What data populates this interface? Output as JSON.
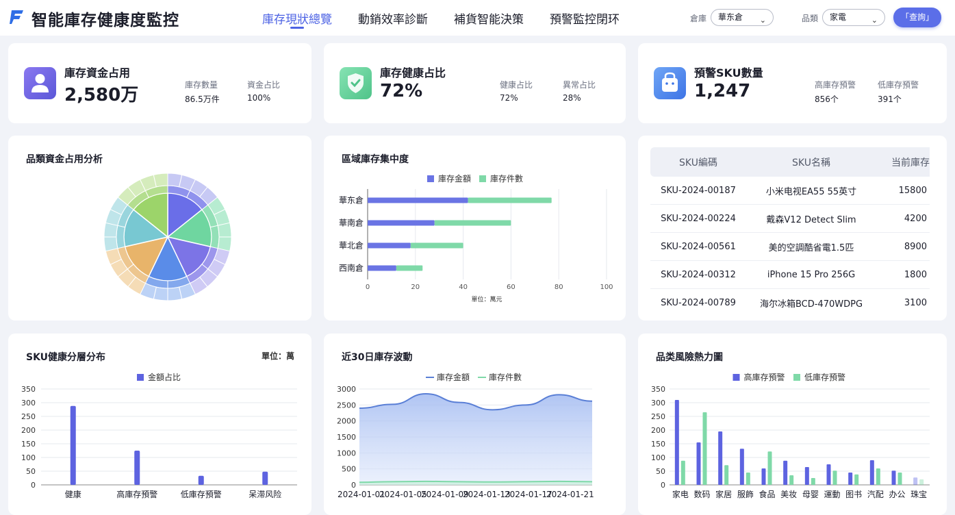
{
  "header": {
    "app_title": "智能庫存健康度監控",
    "tabs": [
      {
        "label": "庫存現狀總覽"
      },
      {
        "label": "動銷效率診斷"
      },
      {
        "label": "補貨智能決策"
      },
      {
        "label": "預警監控閉环"
      }
    ],
    "warehouse_label": "倉庫",
    "warehouse_value": "華东倉",
    "category_label": "品類",
    "category_value": "家電",
    "query_button": "「查詢」",
    "accent_color": "#4d63e4"
  },
  "kpis": [
    {
      "title": "庫存資金占用",
      "value": "2,580万",
      "icon": "user-icon",
      "subs": [
        {
          "label": "庫存數量",
          "value": "86.5万件"
        },
        {
          "label": "資金占比",
          "value": "100%"
        }
      ]
    },
    {
      "title": "庫存健康占比",
      "value": "72%",
      "icon": "shield-check-icon",
      "subs": [
        {
          "label": "健康占比",
          "value": "72%"
        },
        {
          "label": "異常占比",
          "value": "28%"
        }
      ]
    },
    {
      "title": "預警SKU數量",
      "value": "1,247",
      "icon": "bag-icon",
      "subs": [
        {
          "label": "高庫存預警",
          "value": "856个"
        },
        {
          "label": "低庫存預警",
          "value": "391个"
        }
      ]
    }
  ],
  "sunburst": {
    "title": "品類資金占用分析",
    "inner_colors": [
      "#6a6ee8",
      "#6fd6a0",
      "#7c74e6",
      "#5a8ce8",
      "#e8b46a",
      "#78c8d2",
      "#9cd46a"
    ],
    "outer_colors": [
      "#c7c9f4",
      "#b7ecd1",
      "#cfcbf5",
      "#bcd2f6",
      "#f5dcb6",
      "#bfe5ea",
      "#d5ecbc"
    ]
  },
  "region_chart": {
    "title": "區域庫存集中度",
    "legend": [
      "庫存金額",
      "庫存件數"
    ],
    "colors": [
      "#6a74e4",
      "#7fd9a8"
    ],
    "unit": "單位：萬元"
  },
  "sku_table": {
    "headers": [
      "SKU編碼",
      "SKU名稱",
      "当前庫存"
    ],
    "rows": [
      [
        "SKU-2024-00187",
        "小米电视EA55 55英寸",
        "15800"
      ],
      [
        "SKU-2024-00224",
        "戴森V12 Detect Slim",
        "4200"
      ],
      [
        "SKU-2024-00561",
        "美的空調酷省電1.5匹",
        "8900"
      ],
      [
        "SKU-2024-00312",
        "iPhone 15 Pro 256G",
        "1800"
      ],
      [
        "SKU-2024-00789",
        "海尔冰箱BCD-470WDPG",
        "3100"
      ]
    ]
  },
  "sku_health": {
    "title": "SKU健康分層分布",
    "unit": "單位：萬",
    "legend": "金額占比",
    "color": "#5d63e0"
  },
  "trend": {
    "title": "近30日庫存波動",
    "legend": [
      "庫存金額",
      "庫存件數"
    ],
    "colors": [
      "#5a7fd6",
      "#7fd9a8"
    ]
  },
  "heatmap": {
    "title": "品类風險熱力圖",
    "legend": [
      "高庫存預警",
      "低庫存預警"
    ],
    "colors": [
      "#5d63e0",
      "#7fd9a8"
    ]
  },
  "chart_data": [
    {
      "type": "bar",
      "title": "區域庫存集中度",
      "orientation": "horizontal",
      "stacked": true,
      "categories": [
        "華东倉",
        "華南倉",
        "華北倉",
        "西南倉"
      ],
      "series": [
        {
          "name": "庫存金額",
          "values": [
            42,
            28,
            18,
            12
          ]
        },
        {
          "name": "庫存件數",
          "values": [
            35,
            32,
            22,
            11
          ]
        }
      ],
      "xlabel": "單位：萬元",
      "xlim": [
        0,
        100
      ],
      "xticks": [
        0,
        20,
        40,
        60,
        80,
        100
      ],
      "legend": "top",
      "grid": true
    },
    {
      "type": "bar",
      "title": "SKU健康分層分布",
      "categories": [
        "健康",
        "高庫存預警",
        "低庫存預警",
        "呆滞风险"
      ],
      "series": [
        {
          "name": "金額占比",
          "values": [
            288,
            125,
            33,
            48
          ]
        }
      ],
      "ylim": [
        0,
        350
      ],
      "yticks": [
        0,
        50,
        100,
        150,
        200,
        250,
        300,
        350
      ],
      "legend": "top",
      "grid": true
    },
    {
      "type": "area",
      "title": "近30日庫存波動",
      "x": [
        "2024-01-01",
        "2024-01-05",
        "2024-01-09",
        "2024-01-13",
        "2024-01-17",
        "2024-01-21"
      ],
      "series": [
        {
          "name": "庫存金額",
          "values": [
            2400,
            2520,
            2850,
            2580,
            2350,
            2500,
            2820,
            2620
          ]
        },
        {
          "name": "庫存件數",
          "values": [
            80,
            100,
            110,
            100,
            90,
            100,
            110,
            100
          ]
        }
      ],
      "ylim": [
        0,
        3000
      ],
      "yticks": [
        0,
        500,
        1000,
        1500,
        2000,
        2500,
        3000
      ],
      "legend": "top",
      "grid": true
    },
    {
      "type": "bar",
      "title": "品类風險熱力圖",
      "categories": [
        "家电",
        "数码",
        "家居",
        "服飾",
        "食品",
        "美妆",
        "母婴",
        "運動",
        "图书",
        "汽配",
        "办公",
        "珠宝"
      ],
      "series": [
        {
          "name": "高庫存預警",
          "values": [
            310,
            155,
            195,
            132,
            60,
            88,
            65,
            75,
            45,
            90,
            52,
            27
          ]
        },
        {
          "name": "低庫存預警",
          "values": [
            88,
            265,
            72,
            45,
            122,
            35,
            25,
            52,
            38,
            60,
            45,
            20
          ]
        }
      ],
      "ylim": [
        0,
        350
      ],
      "yticks": [
        0,
        50,
        100,
        150,
        200,
        250,
        300,
        350
      ],
      "legend": "top",
      "grid": true
    }
  ]
}
